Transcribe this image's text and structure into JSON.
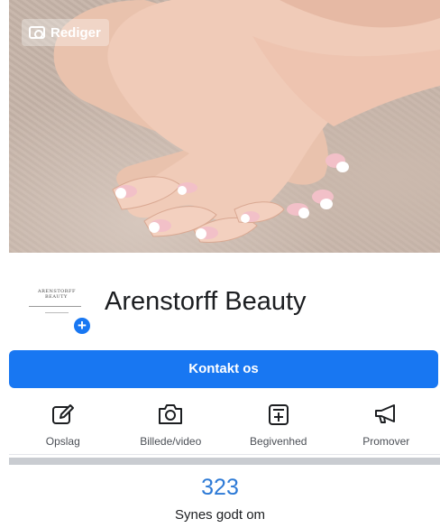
{
  "cover": {
    "edit_label": "Rediger",
    "edit_icon": "camera-icon"
  },
  "profile": {
    "logo_line1": "ARENSTORFF",
    "logo_line2": "BEAUTY",
    "add_icon": "plus-icon",
    "name": "Arenstorff Beauty"
  },
  "contact_button": {
    "label": "Kontakt os",
    "color": "#1877f2"
  },
  "actions": [
    {
      "label": "Opslag",
      "icon": "compose-icon"
    },
    {
      "label": "Billede/video",
      "icon": "camera-icon"
    },
    {
      "label": "Begivenhed",
      "icon": "event-add-icon"
    },
    {
      "label": "Promover",
      "icon": "megaphone-icon"
    }
  ],
  "likes": {
    "count": "323",
    "label": "Synes godt om",
    "color": "#2d7ad6"
  }
}
